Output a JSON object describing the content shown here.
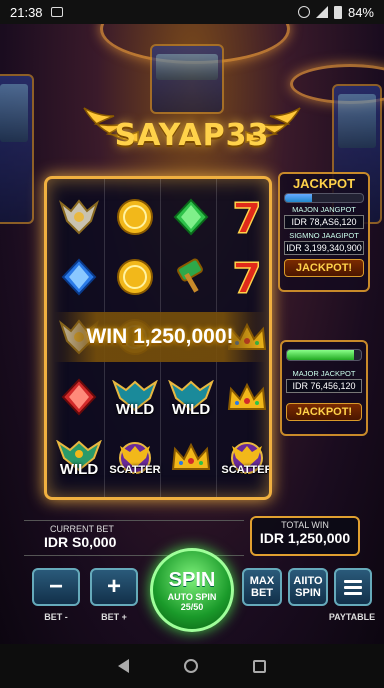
{
  "status": {
    "time": "21:38",
    "battery": "84%",
    "icons": [
      "gallery-icon",
      "alarm-icon",
      "signal-icon",
      "battery-icon"
    ]
  },
  "game": {
    "logo": "SAYAP33",
    "reels": [
      [
        "wings-emblem",
        "gold-coin",
        "green-gem",
        "seven"
      ],
      [
        "blue-gem",
        "gold-coin",
        "emerald-hammer",
        "seven"
      ],
      [
        "wings-emblem",
        "gold-coin",
        "",
        "crown"
      ],
      [
        "red-gem",
        "wild-wings",
        "wild-wings",
        "crown"
      ],
      [
        "wild-eagle",
        "scatter-eagle",
        "crown",
        "scatter-eagle"
      ]
    ],
    "wild_label": "WILD",
    "scatter_label": "SCATTER",
    "win_banner": "WIN 1,250,000!",
    "jackpot_panel": {
      "title": "JACKPOT",
      "major_label": "MAJON JANGPOT",
      "major_value": "IDR 78,AS6,120",
      "grand_label": "SIGMNO JAAGIPOT",
      "grand_value": "IDR 3,199,340,900",
      "button": "JACKPOT!",
      "progress_top": 0.35
    },
    "jackpot_panel2": {
      "major_label": "MAJOR JACKPOT",
      "major_value": "IDR 76,456,120",
      "button": "JACKPOT!",
      "progress": 0.9
    },
    "bet": {
      "label": "CURRENT BET",
      "value": "IDR S0,000"
    },
    "win": {
      "label": "TOTAL WIN",
      "value": "IDR 1,250,000"
    },
    "controls": {
      "minus": "−",
      "plus": "+",
      "bet_minus_caption": "BET -",
      "bet_plus_caption": "BET +",
      "spin": "SPIN",
      "auto_spin": "AUTO SPIN",
      "spin_count": "25/50",
      "max_bet": "MAX BET",
      "auto_spin_btn": "AIITO SPIN",
      "paytable_caption": "PAYTABLE"
    }
  }
}
